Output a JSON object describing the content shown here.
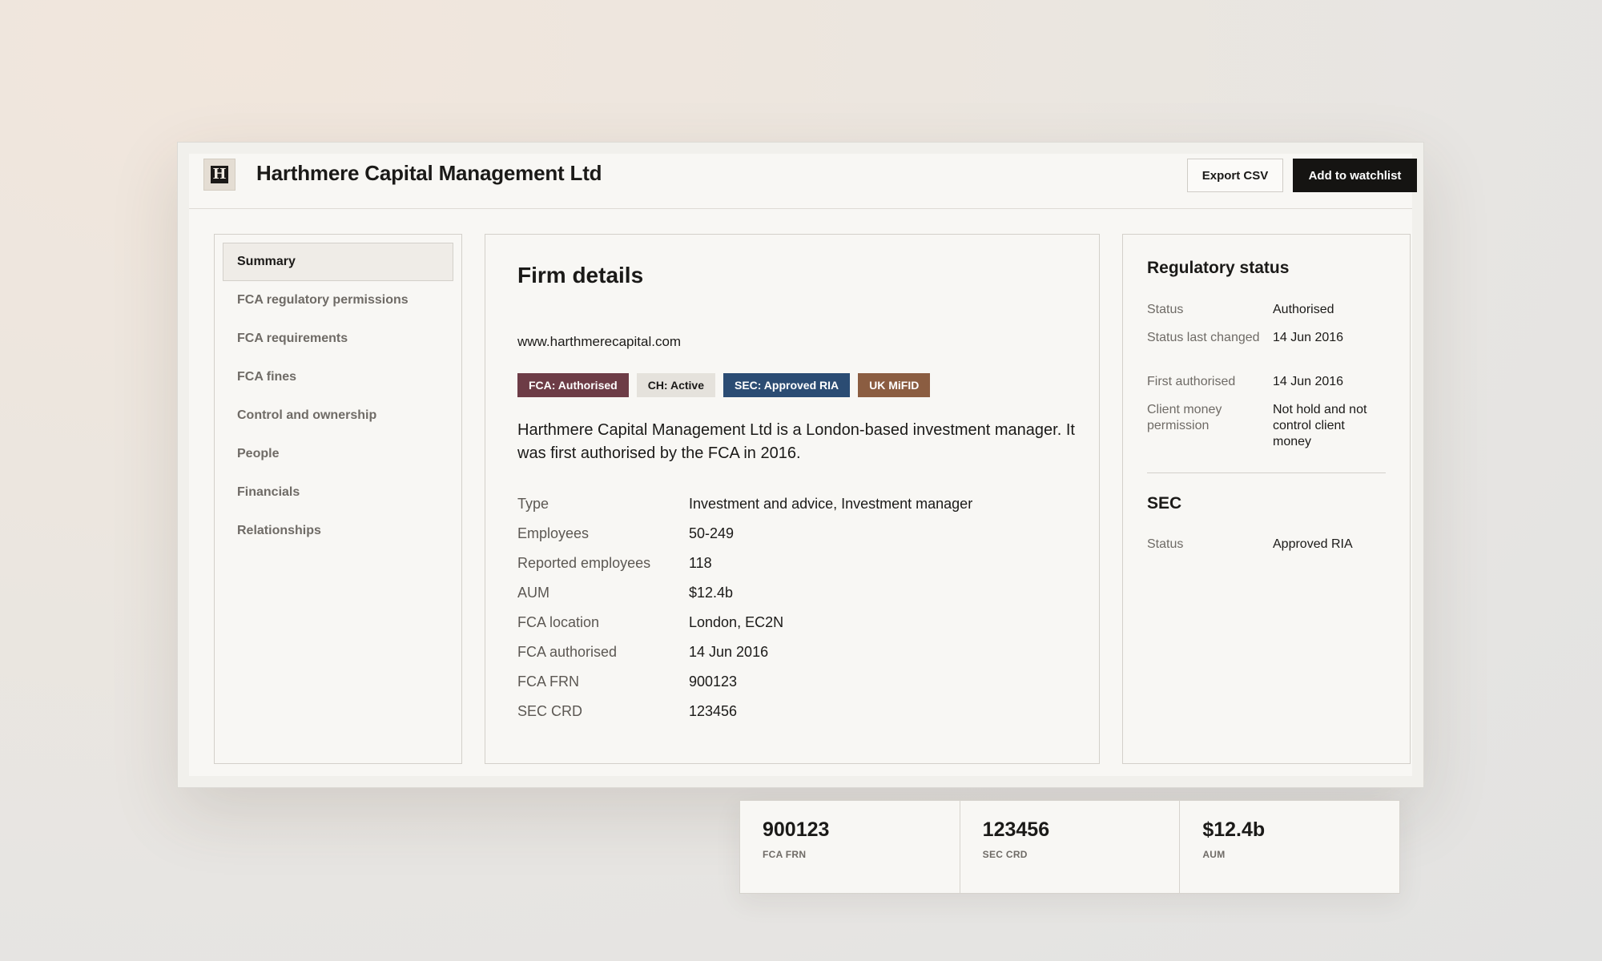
{
  "header": {
    "logo_letter": "H",
    "title": "Harthmere Capital Management Ltd",
    "export_label": "Export CSV",
    "watchlist_label": "Add to watchlist"
  },
  "sidebar": {
    "items": [
      {
        "label": "Summary",
        "active": true
      },
      {
        "label": "FCA regulatory permissions"
      },
      {
        "label": "FCA requirements"
      },
      {
        "label": "FCA fines"
      },
      {
        "label": "Control and ownership"
      },
      {
        "label": "People"
      },
      {
        "label": "Financials"
      },
      {
        "label": "Relationships"
      }
    ]
  },
  "main": {
    "title": "Firm details",
    "website": "www.harthmerecapital.com",
    "tags": [
      {
        "label": "FCA: Authorised",
        "color": "#6d3c46"
      },
      {
        "label": "CH: Active",
        "color": "#e5e2dc"
      },
      {
        "label": "SEC: Approved RIA",
        "color": "#2b4c73"
      },
      {
        "label": "UK MiFID",
        "color": "#8b5d41"
      }
    ],
    "description": "Harthmere Capital Management Ltd is a London-based investment manager. It was first authorised by the FCA in 2016.",
    "facts": [
      {
        "label": "Type",
        "value": "Investment and advice, Investment manager"
      },
      {
        "label": "Employees",
        "value": "50-249"
      },
      {
        "label": "Reported employees",
        "value": "118"
      },
      {
        "label": "AUM",
        "value": "$12.4b"
      },
      {
        "label": "FCA location",
        "value": "London, EC2N"
      },
      {
        "label": "FCA authorised",
        "value": "14 Jun 2016"
      },
      {
        "label": "FCA FRN",
        "value": "900123"
      },
      {
        "label": "SEC CRD",
        "value": "123456"
      }
    ]
  },
  "regulatory": {
    "title": "Regulatory status",
    "rows": [
      {
        "label": "Status",
        "value": "Authorised"
      },
      {
        "label": "Status last changed",
        "value": "14 Jun 2016"
      },
      {
        "label": "First authorised",
        "value": "14 Jun 2016"
      },
      {
        "label": "Client money permission",
        "value": "Not hold and not control client money"
      }
    ],
    "sec_title": "SEC",
    "sec_rows": [
      {
        "label": "Status",
        "value": "Approved RIA"
      }
    ]
  },
  "stats": [
    {
      "value": "900123",
      "label": "FCA FRN"
    },
    {
      "value": "123456",
      "label": "SEC CRD"
    },
    {
      "value": "$12.4b",
      "label": "AUM"
    }
  ]
}
